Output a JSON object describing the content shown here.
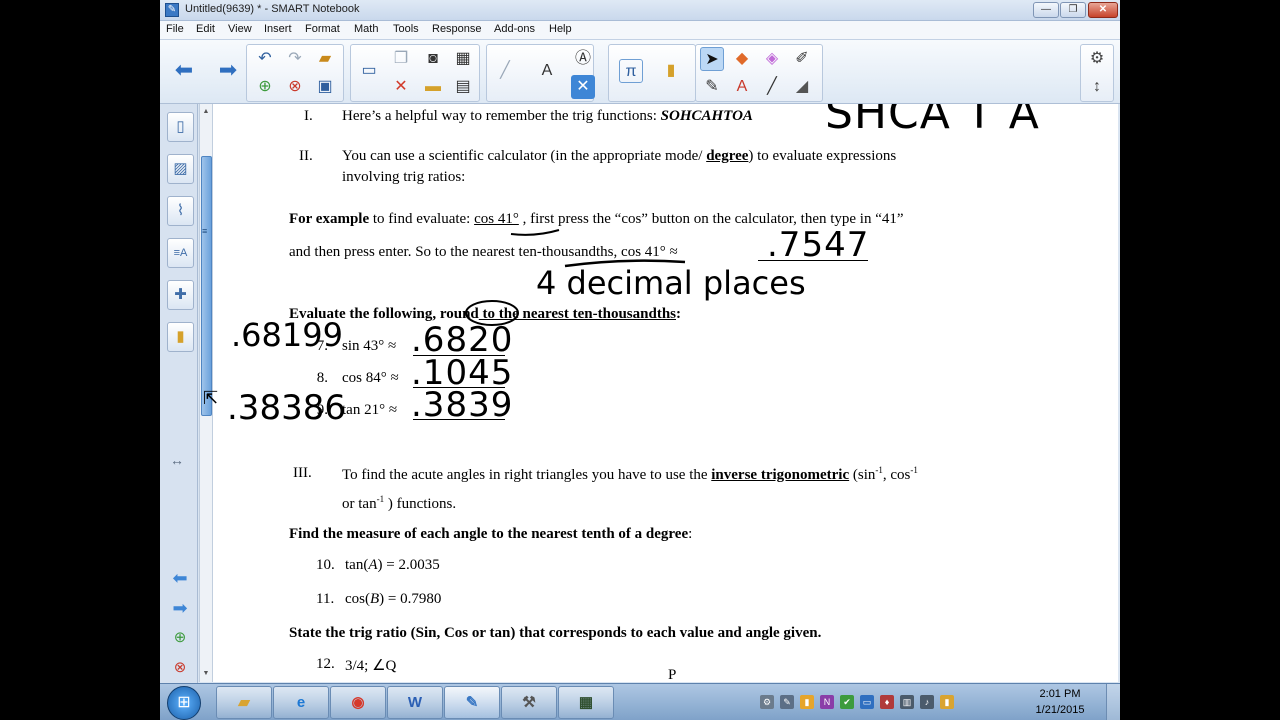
{
  "window": {
    "title": "Untitled(9639) * - SMART Notebook",
    "app_icon": "smart-notebook-icon",
    "min": "—",
    "max": "❐",
    "close": "✕"
  },
  "menu": [
    "File",
    "Edit",
    "View",
    "Insert",
    "Format",
    "Math",
    "Tools",
    "Response",
    "Add-ons",
    "Help"
  ],
  "page": {
    "item_I_num": "I.",
    "item_I_text": "Here’s a helpful way to remember the trig functions:",
    "item_I_bold": "SOHCAHTOA",
    "item_II_num": "II.",
    "item_II_line1_a": "You can use a scientific calculator (in the appropriate mode/ ",
    "item_II_line1_b": "degree",
    "item_II_line1_c": ") to evaluate expressions",
    "item_II_line2": "involving trig ratios:",
    "ex_bold": "For example",
    "ex_line1_a": " to find evaluate:  ",
    "ex_line1_b": "cos 41°",
    "ex_line1_c": " , first press the “cos” button on the calculator, then type in “41”",
    "ex_line2_a": "and then press enter.  So to the nearest ",
    "ex_line2_b": "ten-thousandths",
    "ex_line2_c": ", cos 41° ≈",
    "eval_a": "Evaluate the following, ",
    "eval_b": "round",
    "eval_c": " to the nearest ten-thousandths",
    "eval_d": ":",
    "problems": [
      {
        "num": "7.",
        "expr": "sin 43° ≈"
      },
      {
        "num": "8.",
        "expr": "cos 84° ≈"
      },
      {
        "num": "9.",
        "expr": "tan 21° ≈"
      }
    ],
    "item_III_num": "III.",
    "item_III_line1_a": "To find the acute angles in right triangles you have to use the ",
    "item_III_line1_b": "inverse trigonometric",
    "item_III_line1_c": " (sin",
    "item_III_sup1": "-1",
    "item_III_line1_d": ", cos",
    "item_III_sup2": "-1",
    "item_III_line2_a": "or  tan",
    "item_III_sup3": "-1",
    "item_III_line2_b": " ) functions.",
    "find_bold": "Find the measure of each angle to the nearest tenth of a degree",
    "find_colon": ":",
    "p10_num": "10.",
    "p10_a": "tan(",
    "p10_var": "A",
    "p10_b": ") = 2.0035",
    "p11_num": "11.",
    "p11_a": "cos(",
    "p11_var": "B",
    "p11_b": ") = 0.7980",
    "state_bold": "State the trig ratio (Sin, Cos or tan) that corresponds to each value and angle given.",
    "p12_num": "12.",
    "p12_text": "3/4; ∠Q",
    "p_label": "P"
  },
  "handwriting": {
    "sohcahtoa": "SHCA T A",
    "ex_answer": ".7547",
    "decimal_note": "4 decimal places",
    "calc1": ".68199",
    "calc2": ".38386",
    "ans7": ".6820",
    "ans8": ".1045",
    "ans9": ".3839"
  },
  "taskbar": {
    "apps": [
      "folder-icon",
      "internet-explorer-icon",
      "chrome-icon",
      "word-icon",
      "smart-notebook-icon",
      "tools-icon",
      "calculator-icon"
    ],
    "word_label": "W",
    "time": "2:01 PM",
    "date": "1/21/2015"
  },
  "colors": {
    "accent": "#3e86d6",
    "toolbar_bg": "#dde8f4",
    "page_bg": "#ffffff",
    "taskbar": "#7fa2c9"
  }
}
